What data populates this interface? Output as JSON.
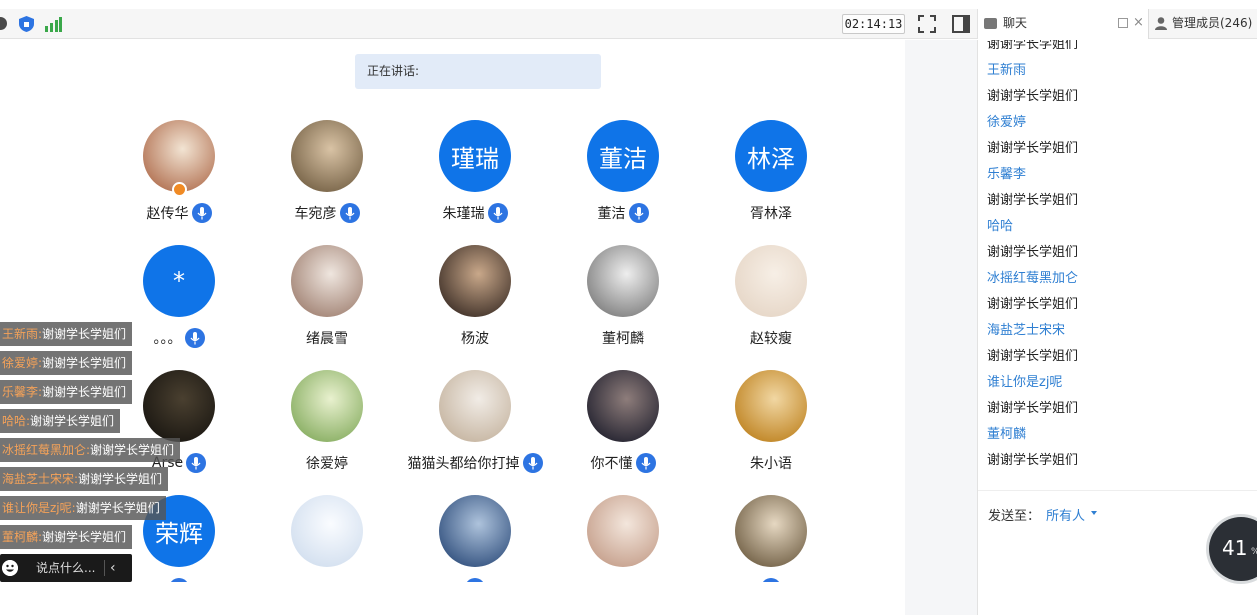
{
  "toolbar": {
    "timer": "02:14:13",
    "icons": [
      "record-icon",
      "shield-icon",
      "signal-icon",
      "fullscreen-icon",
      "layout-icon"
    ]
  },
  "stage": {
    "speaking_label": "正在讲话:"
  },
  "participants": [
    {
      "name": "赵传华",
      "avatar_type": "photo",
      "mic": true,
      "host": true
    },
    {
      "name": "车宛彦",
      "avatar_type": "photo",
      "mic": true
    },
    {
      "name": "朱瑾瑞",
      "avatar_type": "text",
      "avatar_text": "瑾瑞",
      "mic": true
    },
    {
      "name": "董洁",
      "avatar_type": "text",
      "avatar_text": "董洁",
      "mic": true
    },
    {
      "name": "胥林泽",
      "avatar_type": "text",
      "avatar_text": "林泽",
      "mic": false
    },
    {
      "name": "。。。",
      "avatar_type": "text",
      "avatar_text": "*",
      "mic": true
    },
    {
      "name": "绪晨雪",
      "avatar_type": "photo",
      "mic": false
    },
    {
      "name": "杨波",
      "avatar_type": "photo",
      "mic": false
    },
    {
      "name": "董柯麟",
      "avatar_type": "photo",
      "mic": false
    },
    {
      "name": "赵较瘦",
      "avatar_type": "photo",
      "mic": false
    },
    {
      "name": "Arse",
      "avatar_type": "photo",
      "mic": true
    },
    {
      "name": "徐爱婷",
      "avatar_type": "photo",
      "mic": false
    },
    {
      "name": "猫猫头都给你打掉",
      "avatar_type": "photo",
      "mic": true
    },
    {
      "name": "你不懂",
      "avatar_type": "photo",
      "mic": true
    },
    {
      "name": "朱小语",
      "avatar_type": "photo",
      "mic": false
    },
    {
      "name": "",
      "avatar_type": "text",
      "avatar_text": "荣辉",
      "mic": true
    },
    {
      "name": "",
      "avatar_type": "photo",
      "mic": false
    },
    {
      "name": "",
      "avatar_type": "photo",
      "mic": true
    },
    {
      "name": "",
      "avatar_type": "photo",
      "mic": false
    },
    {
      "name": "",
      "avatar_type": "photo",
      "mic": true
    }
  ],
  "floating_chat": [
    {
      "name": "王新雨:",
      "text": "谢谢学长学姐们"
    },
    {
      "name": "徐爱婷:",
      "text": "谢谢学长学姐们"
    },
    {
      "name": "乐馨李:",
      "text": "谢谢学长学姐们"
    },
    {
      "name": "哈哈:",
      "text": "谢谢学长学姐们"
    },
    {
      "name": "冰摇红莓黑加仑:",
      "text": "谢谢学长学姐们"
    },
    {
      "name": "海盐芝士宋宋:",
      "text": "谢谢学长学姐们"
    },
    {
      "name": "谁让你是zj呢:",
      "text": "谢谢学长学姐们"
    },
    {
      "name": "董柯麟:",
      "text": "谢谢学长学姐们"
    }
  ],
  "say_bar": {
    "placeholder": "说点什么...",
    "arrow": "‹"
  },
  "right_panel": {
    "chat_tab": "聊天",
    "close_glyph": "×",
    "members_tab": "管理成员(246)",
    "messages": [
      {
        "type": "text",
        "value": "谢谢学长学姐们"
      },
      {
        "type": "sender",
        "value": "王新雨"
      },
      {
        "type": "text",
        "value": "谢谢学长学姐们"
      },
      {
        "type": "sender",
        "value": "徐爱婷"
      },
      {
        "type": "text",
        "value": "谢谢学长学姐们"
      },
      {
        "type": "sender",
        "value": "乐馨李"
      },
      {
        "type": "text",
        "value": "谢谢学长学姐们"
      },
      {
        "type": "sender",
        "value": "哈哈"
      },
      {
        "type": "text",
        "value": "谢谢学长学姐们"
      },
      {
        "type": "sender",
        "value": "冰摇红莓黑加仑"
      },
      {
        "type": "text",
        "value": "谢谢学长学姐们"
      },
      {
        "type": "sender",
        "value": "海盐芝士宋宋"
      },
      {
        "type": "text",
        "value": "谢谢学长学姐们"
      },
      {
        "type": "sender",
        "value": "谁让你是zj呢"
      },
      {
        "type": "text",
        "value": "谢谢学长学姐们"
      },
      {
        "type": "sender",
        "value": "董柯麟"
      },
      {
        "type": "text",
        "value": "谢谢学长学姐们"
      }
    ],
    "send_to_label": "发送至：",
    "send_target": "所有人"
  },
  "progress": {
    "value": "41",
    "unit": "%"
  },
  "colors": {
    "accent": "#0f74e8",
    "mic": "#2d74e2",
    "sender": "#2f7fd2",
    "float_name": "#f4a259"
  }
}
